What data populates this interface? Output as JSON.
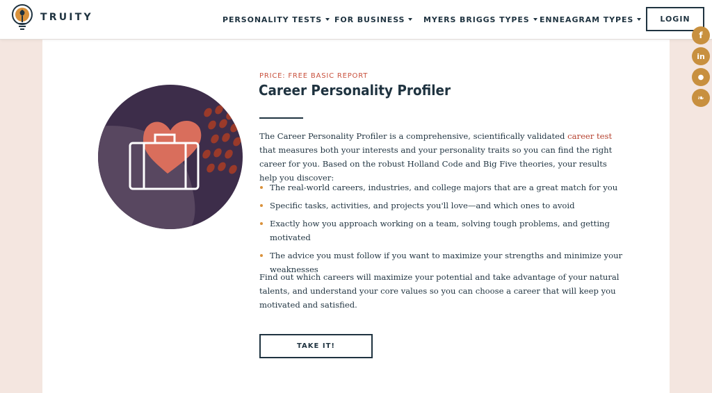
{
  "brand": {
    "name": "TRUITY"
  },
  "nav": {
    "items": [
      {
        "label": "PERSONALITY TESTS"
      },
      {
        "label": "FOR BUSINESS"
      },
      {
        "label": "MYERS BRIGGS TYPES"
      },
      {
        "label": "ENNEAGRAM TYPES"
      }
    ],
    "login_label": "LOGIN"
  },
  "product": {
    "price": "PRICE: FREE BASIC REPORT",
    "title": "Career Personality Profiler",
    "intro_before": "The Career Personality Profiler is a comprehensive, scientifically validated ",
    "intro_link": "career test",
    "intro_after": " that measures both your interests and your personality traits so you can find the right career for you. Based on the robust Holland Code and Big Five theories, your results help you discover:",
    "bullets": [
      "The real-world careers, industries, and college majors that are a great match for you",
      "Specific tasks, activities, and projects you'll love—and which ones to avoid",
      "Exactly how you approach working on a team, solving tough problems, and getting motivated",
      "The advice you must follow if you want to maximize your strengths and minimize your weaknesses"
    ],
    "outro": "Find out which careers will maximize your potential and take advantage of your natural talents, and understand your core values so you can choose a career that will keep you motivated and satisfied.",
    "cta_label": "TAKE IT!"
  },
  "social": {
    "facebook_glyph": "f",
    "linkedin_glyph": "in",
    "reddit_glyph": "●",
    "twitter_glyph": "❧"
  },
  "colors": {
    "navy": "#1f3340",
    "accent_red": "#c8503c",
    "bullet_gold": "#d9913a",
    "social_gold": "#c8903f",
    "page_bg": "#f4e6e0",
    "circle_purple": "#3d2d4a",
    "heart_coral": "#d96e5c"
  }
}
